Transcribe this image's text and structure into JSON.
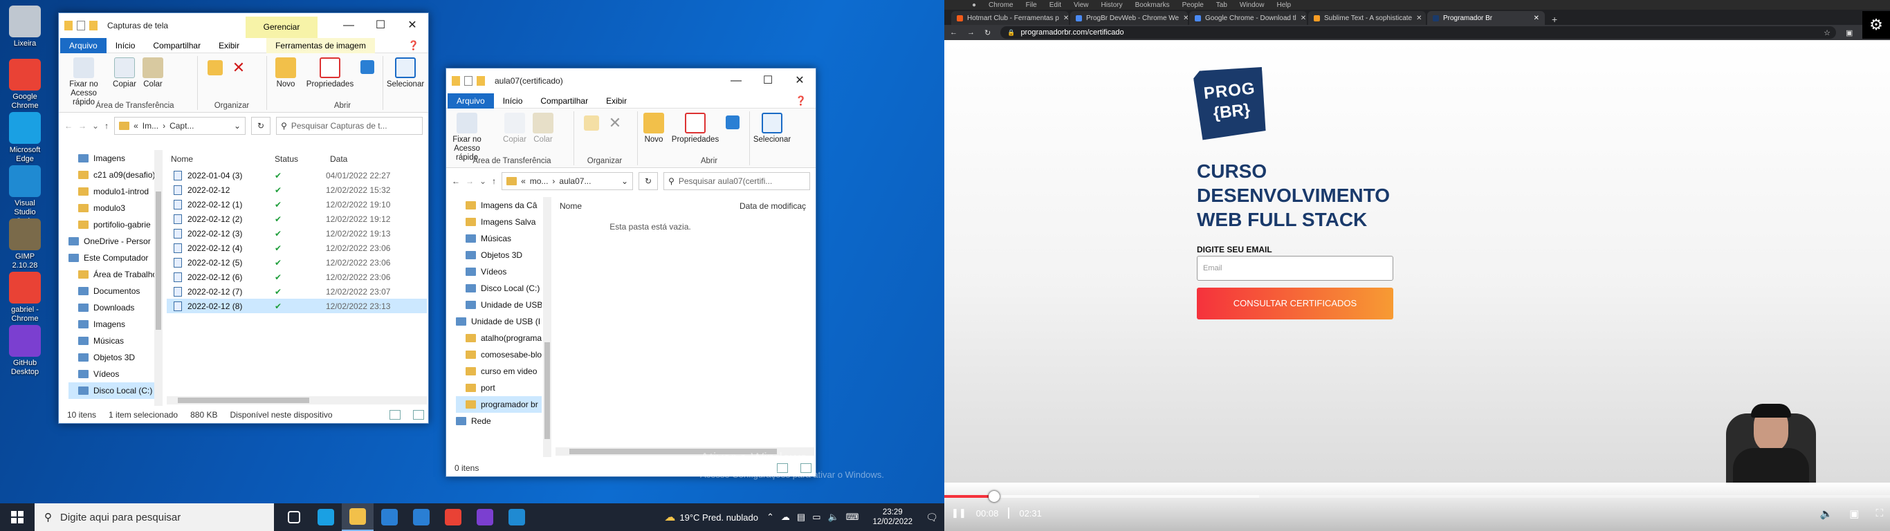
{
  "desktop": {
    "icons": [
      {
        "label": "Lixeira",
        "color": "#bfc7d0"
      },
      {
        "label": "Google Chrome",
        "color": "#e94235"
      },
      {
        "label": "Microsoft Edge",
        "color": "#1aa0e3"
      },
      {
        "label": "Visual Studio Code",
        "color": "#1f8ad2"
      },
      {
        "label": "GIMP 2.10.28",
        "color": "#7a6a4a"
      },
      {
        "label": "gabriel - Chrome",
        "color": "#e94235"
      },
      {
        "label": "GitHub Desktop",
        "color": "#7b3fd0"
      }
    ],
    "watermark": {
      "title": "Ativar o Windows",
      "sub": "Acesse Configurações para ativar o Windows."
    }
  },
  "explorer1": {
    "title": "Capturas de tela",
    "context_tab": "Gerenciar",
    "context_sub": "Ferramentas de imagem",
    "tabs": [
      "Arquivo",
      "Início",
      "Compartilhar",
      "Exibir"
    ],
    "ribbon": {
      "pin": "Fixar no Acesso rápido",
      "copy": "Copiar",
      "paste": "Colar",
      "group_clip": "Área de Transferência",
      "group_org": "Organizar",
      "new": "Novo",
      "props": "Propriedades",
      "group_open": "Abrir",
      "select": "Selecionar"
    },
    "address": [
      "Im...",
      "Capt..."
    ],
    "search_placeholder": "Pesquisar Capturas de t...",
    "nav": [
      "Imagens",
      "c21 a09(desafio)",
      "modulo1-introd",
      "modulo3",
      "portifolio-gabrie",
      "OneDrive - Persor",
      "Este Computador",
      "Área de Trabalho",
      "Documentos",
      "Downloads",
      "Imagens",
      "Músicas",
      "Objetos 3D",
      "Vídeos",
      "Disco Local (C:)"
    ],
    "cols": {
      "name": "Nome",
      "status": "Status",
      "date": "Data"
    },
    "files": [
      {
        "name": "2022-01-04 (3)",
        "date": "04/01/2022 22:27"
      },
      {
        "name": "2022-02-12",
        "date": "12/02/2022 15:32"
      },
      {
        "name": "2022-02-12 (1)",
        "date": "12/02/2022 19:10"
      },
      {
        "name": "2022-02-12 (2)",
        "date": "12/02/2022 19:12"
      },
      {
        "name": "2022-02-12 (3)",
        "date": "12/02/2022 19:13"
      },
      {
        "name": "2022-02-12 (4)",
        "date": "12/02/2022 23:06"
      },
      {
        "name": "2022-02-12 (5)",
        "date": "12/02/2022 23:06"
      },
      {
        "name": "2022-02-12 (6)",
        "date": "12/02/2022 23:06"
      },
      {
        "name": "2022-02-12 (7)",
        "date": "12/02/2022 23:07"
      },
      {
        "name": "2022-02-12 (8)",
        "date": "12/02/2022 23:13"
      }
    ],
    "status": {
      "count": "10 itens",
      "selected": "1 item selecionado",
      "size": "880 KB",
      "avail": "Disponível neste dispositivo"
    }
  },
  "explorer2": {
    "title": "aula07(certificado)",
    "tabs": [
      "Arquivo",
      "Início",
      "Compartilhar",
      "Exibir"
    ],
    "ribbon": {
      "pin": "Fixar no Acesso rápido",
      "copy": "Copiar",
      "paste": "Colar",
      "group_clip": "Área de Transferência",
      "group_org": "Organizar",
      "new": "Novo",
      "props": "Propriedades",
      "group_open": "Abrir",
      "select": "Selecionar"
    },
    "address": [
      "mo...",
      "aula07..."
    ],
    "search_placeholder": "Pesquisar aula07(certifi...",
    "nav": [
      "Imagens da Câ",
      "Imagens Salva",
      "Músicas",
      "Objetos 3D",
      "Vídeos",
      "Disco Local (C:)",
      "Unidade de USB",
      "Unidade de USB (I",
      "atalho(programa",
      "comosesabe-blo",
      "curso em video",
      "port",
      "programador br",
      "Rede"
    ],
    "cols": {
      "name": "Nome",
      "date": "Data de modificaç"
    },
    "empty": "Esta pasta está vazia.",
    "status": {
      "count": "0 itens"
    }
  },
  "taskbar": {
    "search": "Digite aqui para pesquisar",
    "weather": "19°C  Pred. nublado",
    "time": "23:29",
    "date": "12/02/2022",
    "apps": [
      {
        "name": "task-view",
        "color": "#ffffff"
      },
      {
        "name": "edge",
        "color": "#1aa0e3"
      },
      {
        "name": "file-explorer",
        "color": "#f2c04a"
      },
      {
        "name": "store",
        "color": "#2a7fd4"
      },
      {
        "name": "mail",
        "color": "#2a7fd4"
      },
      {
        "name": "chrome",
        "color": "#e94235"
      },
      {
        "name": "github",
        "color": "#7b3fd0"
      },
      {
        "name": "vscode",
        "color": "#1f8ad2"
      }
    ]
  },
  "chrome": {
    "menu": [
      "Chrome",
      "File",
      "Edit",
      "View",
      "History",
      "Bookmarks",
      "People",
      "Tab",
      "Window",
      "Help"
    ],
    "tabs": [
      "Hotmart Club - Ferramentas p",
      "ProgBr DevWeb - Chrome We",
      "Google Chrome - Download tl",
      "Sublime Text - A sophisticate",
      "Programador Br"
    ],
    "url": "programadorbr.com/certificado"
  },
  "landing": {
    "logo_top": "PROG",
    "logo_bottom": "{BR}",
    "headline": [
      "CURSO",
      "DESENVOLVIMENTO",
      "WEB FULL STACK"
    ],
    "email_label": "DIGITE SEU EMAIL",
    "email_placeholder": "Email",
    "button": "CONSULTAR CERTIFICADOS",
    "brand_color": "#1a3a6b",
    "accent_color": "#f5323c"
  },
  "player": {
    "current": "00:08",
    "duration": "02:31",
    "progress": 0.053
  }
}
